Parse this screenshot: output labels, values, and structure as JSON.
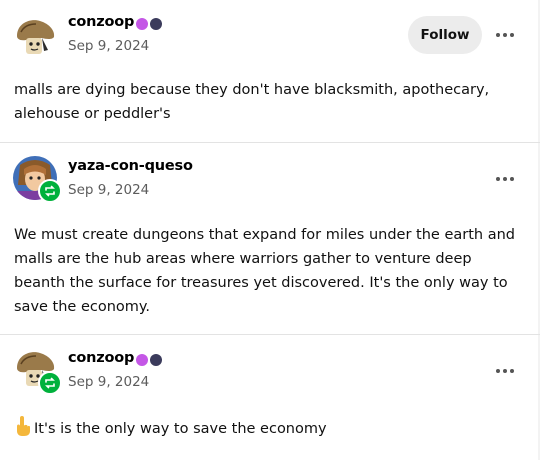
{
  "posts": [
    {
      "username": "conzoop",
      "date": "Sep 9, 2024",
      "follow_label": "Follow",
      "text": "malls are dying because they don't have blacksmith, apothecary, alehouse or peddler's",
      "avatar_icon": "mushroom-avatar-icon",
      "badge_colors": [
        "#c457e6",
        "#3b3b5c"
      ]
    },
    {
      "username": "yaza-con-queso",
      "date": "Sep 9, 2024",
      "text": "We must create dungeons that expand for miles under the earth and malls are the hub areas where warriors gather to venture deep beanth the surface for treasures yet discovered. It's the only way to save the economy.",
      "avatar_icon": "character-avatar-icon",
      "reblog_icon": "reblog-icon"
    },
    {
      "username": "conzoop",
      "date": "Sep 9, 2024",
      "text": "It's is the only way to save the economy",
      "avatar_icon": "mushroom-avatar-icon",
      "reblog_icon": "reblog-icon",
      "badge_colors": [
        "#c457e6",
        "#3b3b5c"
      ],
      "emoji_icon": "pointing-up-hand-icon"
    }
  ],
  "colors": {
    "follow_bg": "#ececec",
    "reblog_green": "#00b13c",
    "date_gray": "#5c5c5c",
    "divider": "#e3e3e3"
  }
}
